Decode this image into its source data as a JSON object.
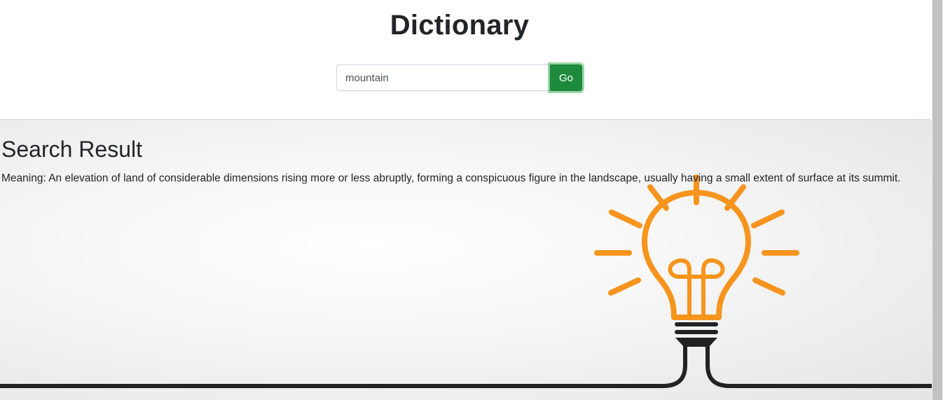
{
  "header": {
    "title": "Dictionary"
  },
  "search": {
    "value": "mountain",
    "go_label": "Go"
  },
  "result": {
    "heading": "Search Result",
    "meaning": "Meaning: An elevation of land of considerable dimensions rising more or less abruptly, forming a conspicuous figure in the landscape, usually having a small extent of surface at its summit."
  },
  "colors": {
    "go_button": "#1e8a3c",
    "bulb": "#f7941d",
    "wire": "#222222"
  },
  "icons": {
    "illustration": "lightbulb-icon"
  }
}
